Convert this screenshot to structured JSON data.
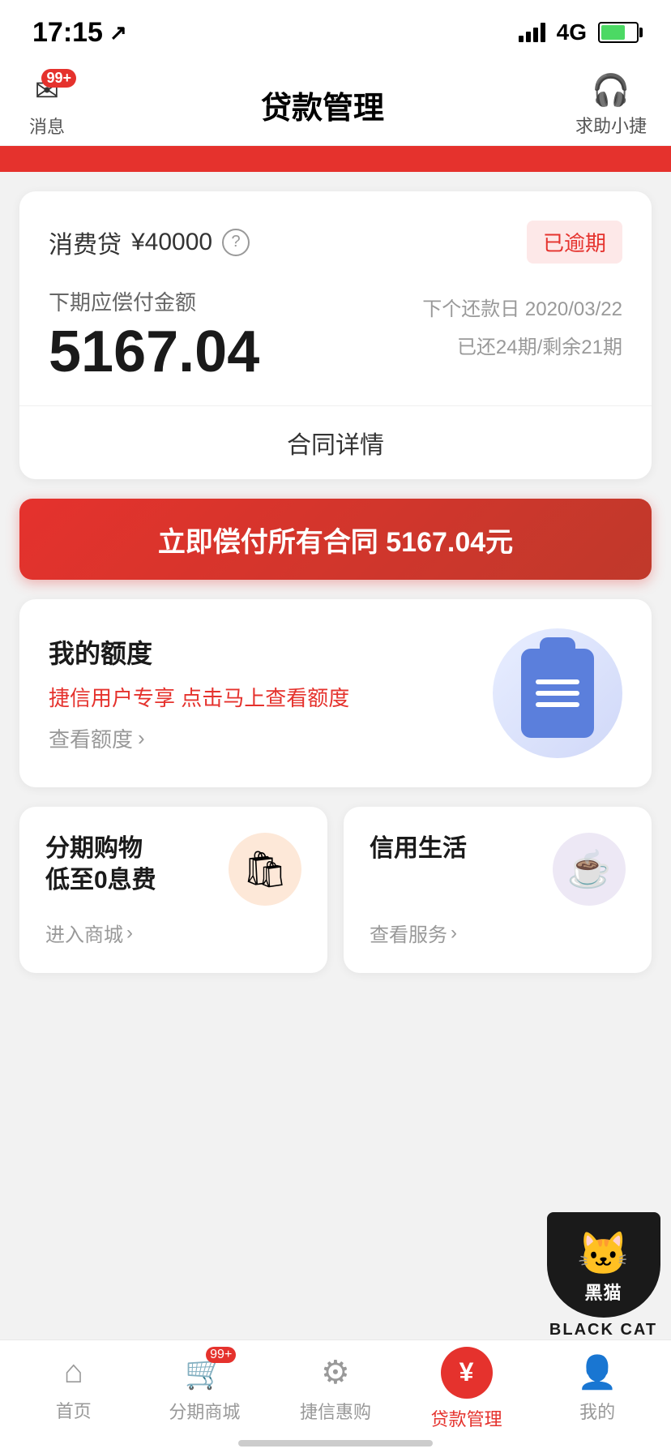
{
  "statusBar": {
    "time": "17:15",
    "network": "4G"
  },
  "header": {
    "messageLabel": "消息",
    "messageBadge": "99+",
    "title": "贷款管理",
    "helpLabel": "求助小捷"
  },
  "loanCard": {
    "typeName": "消费贷",
    "amount": "¥40000",
    "overdueBadge": "已逾期",
    "dueLabel": "下期应偿付金额",
    "dueAmount": "5167.04",
    "nextDateLabel": "下个还款日",
    "nextDate": "2020/03/22",
    "periodsText": "已还24期/剩余21期",
    "contractDetail": "合同详情"
  },
  "repayButton": {
    "label": "立即偿付所有合同 5167.04元"
  },
  "creditCard": {
    "title": "我的额度",
    "subText": "捷信用户专享 点击马上查看额度",
    "linkLabel": "查看额度",
    "linkChevron": "›"
  },
  "smallCards": [
    {
      "title": "分期购物\n低至0息费",
      "linkLabel": "进入商城",
      "linkChevron": "›",
      "iconType": "bag"
    },
    {
      "title": "信用生活",
      "linkLabel": "查看服务",
      "linkChevron": "›",
      "iconType": "coffee"
    }
  ],
  "bottomTabs": [
    {
      "label": "首页",
      "icon": "home",
      "active": false
    },
    {
      "label": "分期商城",
      "icon": "cart",
      "active": false,
      "badge": "99+"
    },
    {
      "label": "捷信惠购",
      "icon": "gear",
      "active": false
    },
    {
      "label": "贷款管理",
      "icon": "yuan",
      "active": true
    },
    {
      "label": "我的",
      "icon": "person",
      "active": false
    }
  ],
  "watermark": {
    "text": "BLACK CAT"
  }
}
